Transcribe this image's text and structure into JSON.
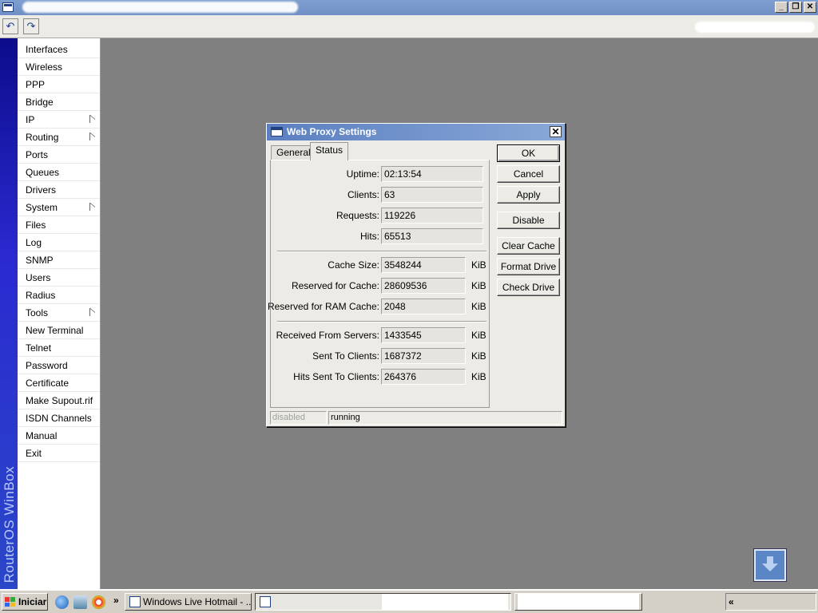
{
  "window": {
    "title_bar_controls": [
      "minimize-icon",
      "restore-icon",
      "close-icon"
    ]
  },
  "toolbar": {
    "undo_icon": "undo-icon",
    "redo_icon": "redo-icon"
  },
  "sidebar": {
    "brand": "RouterOS WinBox",
    "items": [
      {
        "label": "Interfaces",
        "submenu": false
      },
      {
        "label": "Wireless",
        "submenu": false
      },
      {
        "label": "PPP",
        "submenu": false
      },
      {
        "label": "Bridge",
        "submenu": false
      },
      {
        "label": "IP",
        "submenu": true
      },
      {
        "label": "Routing",
        "submenu": true
      },
      {
        "label": "Ports",
        "submenu": false
      },
      {
        "label": "Queues",
        "submenu": false
      },
      {
        "label": "Drivers",
        "submenu": false
      },
      {
        "label": "System",
        "submenu": true
      },
      {
        "label": "Files",
        "submenu": false
      },
      {
        "label": "Log",
        "submenu": false
      },
      {
        "label": "SNMP",
        "submenu": false
      },
      {
        "label": "Users",
        "submenu": false
      },
      {
        "label": "Radius",
        "submenu": false
      },
      {
        "label": "Tools",
        "submenu": true
      },
      {
        "label": "New Terminal",
        "submenu": false
      },
      {
        "label": "Telnet",
        "submenu": false
      },
      {
        "label": "Password",
        "submenu": false
      },
      {
        "label": "Certificate",
        "submenu": false
      },
      {
        "label": "Make Supout.rif",
        "submenu": false
      },
      {
        "label": "ISDN Channels",
        "submenu": false
      },
      {
        "label": "Manual",
        "submenu": false
      },
      {
        "label": "Exit",
        "submenu": false
      }
    ]
  },
  "dialog": {
    "title": "Web Proxy Settings",
    "close_label": "✕",
    "tabs": [
      {
        "label": "General",
        "active": false
      },
      {
        "label": "Status",
        "active": true
      }
    ],
    "fields": {
      "uptime": {
        "label": "Uptime:",
        "value": "02:13:54"
      },
      "clients": {
        "label": "Clients:",
        "value": "63"
      },
      "requests": {
        "label": "Requests:",
        "value": "119226"
      },
      "hits": {
        "label": "Hits:",
        "value": "65513"
      },
      "cache_size": {
        "label": "Cache Size:",
        "value": "3548244",
        "unit": "KiB"
      },
      "reserved_cache": {
        "label": "Reserved for Cache:",
        "value": "28609536",
        "unit": "KiB"
      },
      "reserved_ram": {
        "label": "Reserved for RAM Cache:",
        "value": "2048",
        "unit": "KiB"
      },
      "received": {
        "label": "Received From Servers:",
        "value": "1433545",
        "unit": "KiB"
      },
      "sent": {
        "label": "Sent To Clients:",
        "value": "1687372",
        "unit": "KiB"
      },
      "hits_sent": {
        "label": "Hits Sent To Clients:",
        "value": "264376",
        "unit": "KiB"
      }
    },
    "buttons": {
      "ok": "OK",
      "cancel": "Cancel",
      "apply": "Apply",
      "disable": "Disable",
      "clear_cache": "Clear Cache",
      "format_drive": "Format Drive",
      "check_drive": "Check Drive"
    },
    "status": {
      "state": "disabled",
      "running": "running"
    }
  },
  "taskbar": {
    "start_label": "Iniciar",
    "quick_launch_more": "»",
    "task_label": "Windows Live Hotmail - ...",
    "tray_chevron": "«"
  },
  "colors": {
    "desktop": "#808080",
    "sidebar_brand_bar": "#2a2ad0",
    "dialog_title": "#5b7fc0"
  }
}
